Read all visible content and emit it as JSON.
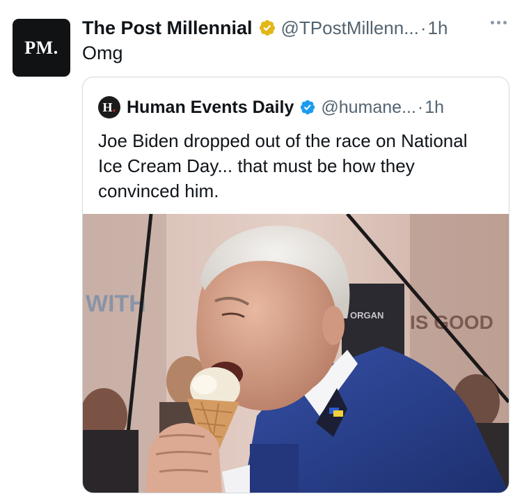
{
  "tweet": {
    "avatar_text": "PM.",
    "author_name": "The Post Millennial",
    "handle": "@TPostMillenn...",
    "separator": "·",
    "time": "1h",
    "text": "Omg",
    "verified_badge_icon": "gold-check-badge-icon",
    "more_icon": "more-options-icon"
  },
  "quoted": {
    "avatar_text": "H",
    "avatar_dot": ".",
    "author_name": "Human Events Daily",
    "handle": "@humane...",
    "separator": "·",
    "time": "1h",
    "text": "Joe Biden dropped out of the race on National Ice Cream Day... that must be how they convinced him.",
    "verified_badge_icon": "blue-check-badge-icon",
    "photo": {
      "subject": "man-eating-ice-cream-cone-photo",
      "sign_left": "WITH",
      "sign_center": "ORGAN",
      "sign_right": "IS GOOD"
    }
  },
  "colors": {
    "text": "#0f1419",
    "secondary": "#536471",
    "border": "#cfd9de",
    "gold_badge": "#e2b719",
    "blue_badge": "#1d9bf0"
  }
}
